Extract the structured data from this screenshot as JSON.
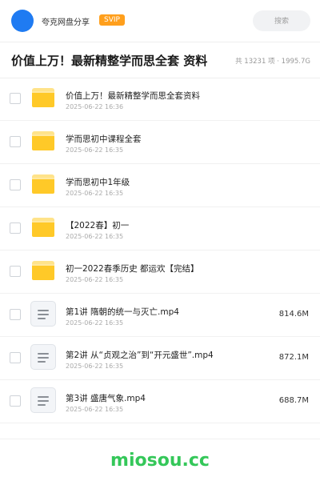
{
  "header": {
    "brand": "夸克网盘分享",
    "badge": "SVIP",
    "search_placeholder": "搜索"
  },
  "title": {
    "text": "价值上万！最新精整学而思全套 资料",
    "summary": "共 13231 项 · 1995.7G"
  },
  "items": [
    {
      "type": "folder",
      "name": "价值上万！最新精整学而思全套资料",
      "date": "2025-06-22 16:36",
      "size": ""
    },
    {
      "type": "folder",
      "name": "学而思初中课程全套",
      "date": "2025-06-22 16:35",
      "size": ""
    },
    {
      "type": "folder",
      "name": "学而思初中1年级",
      "date": "2025-06-22 16:35",
      "size": ""
    },
    {
      "type": "folder",
      "name": "【2022春】初一",
      "date": "2025-06-22 16:35",
      "size": ""
    },
    {
      "type": "folder",
      "name": "初一2022春季历史 都运欢【完结】",
      "date": "2025-06-22 16:35",
      "size": ""
    },
    {
      "type": "file",
      "name": "第1讲 隋朝的统一与灭亡.mp4",
      "date": "2025-06-22 16:35",
      "size": "814.6M"
    },
    {
      "type": "file",
      "name": "第2讲 从“贞观之治”到“开元盛世”.mp4",
      "date": "2025-06-22 16:35",
      "size": "872.1M"
    },
    {
      "type": "file",
      "name": "第3讲 盛唐气象.mp4",
      "date": "2025-06-22 16:35",
      "size": "688.7M"
    }
  ],
  "watermark": "miosou.cc",
  "colors": {
    "accent": "#1f7bf2",
    "badge": "#ff9f1c",
    "folder": "#ffc928",
    "watermark": "#34c759"
  }
}
